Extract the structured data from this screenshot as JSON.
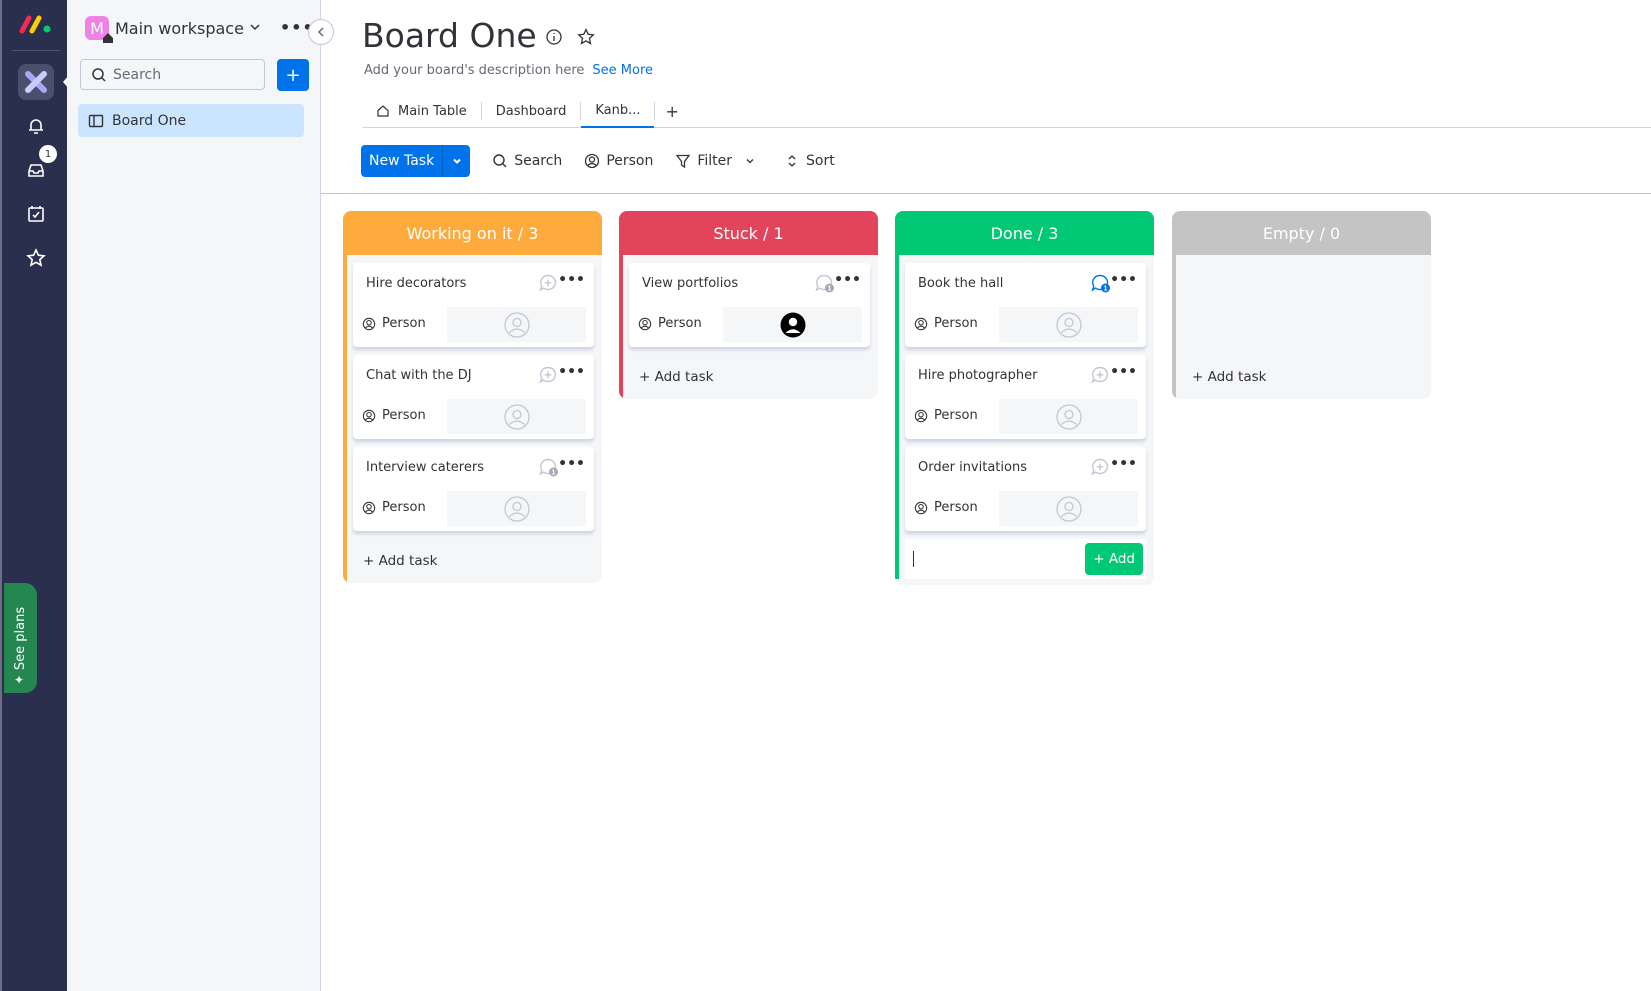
{
  "nav": {
    "notifications_badge": "1",
    "see_plans_label": "See plans"
  },
  "workspace": {
    "avatar_letter": "M",
    "name": "Main workspace",
    "search_placeholder": "Search",
    "add_label": "+",
    "boards": [
      {
        "label": "Board One"
      }
    ]
  },
  "board": {
    "title": "Board One",
    "description": "Add your board's description here",
    "see_more": "See More",
    "tabs": [
      {
        "label": "Main Table",
        "active": false
      },
      {
        "label": "Dashboard",
        "active": false
      },
      {
        "label": "Kanb...",
        "active": true
      }
    ],
    "add_tab": "+"
  },
  "toolbar": {
    "new_task": "New Task",
    "search": "Search",
    "person": "Person",
    "filter": "Filter",
    "sort": "Sort"
  },
  "colors": {
    "working": "#fdab3d",
    "stuck": "#e2445c",
    "done": "#00c875",
    "empty": "#c4c4c4",
    "primary": "#0073ea"
  },
  "columns": [
    {
      "title": "Working on it / 3",
      "status": "working",
      "cards": [
        {
          "name": "Hire decorators",
          "updates": "add",
          "person_label": "Person",
          "assigned": false
        },
        {
          "name": "Chat with the DJ",
          "updates": "add",
          "person_label": "Person",
          "assigned": false
        },
        {
          "name": "Interview caterers",
          "updates": "1",
          "person_label": "Person",
          "assigned": false
        }
      ],
      "add_task": "+ Add task"
    },
    {
      "title": "Stuck / 1",
      "status": "stuck",
      "cards": [
        {
          "name": "View portfolios",
          "updates": "1",
          "person_label": "Person",
          "assigned": true
        }
      ],
      "add_task": "+ Add task"
    },
    {
      "title": "Done / 3",
      "status": "done",
      "cards": [
        {
          "name": "Book the hall",
          "updates": "1-unread",
          "person_label": "Person",
          "assigned": false
        },
        {
          "name": "Hire photographer",
          "updates": "add",
          "person_label": "Person",
          "assigned": false
        },
        {
          "name": "Order invitations",
          "updates": "add",
          "person_label": "Person",
          "assigned": false
        }
      ],
      "add_button": "+ Add"
    },
    {
      "title": "Empty / 0",
      "status": "empty",
      "cards": [],
      "add_task": "+ Add task"
    }
  ]
}
